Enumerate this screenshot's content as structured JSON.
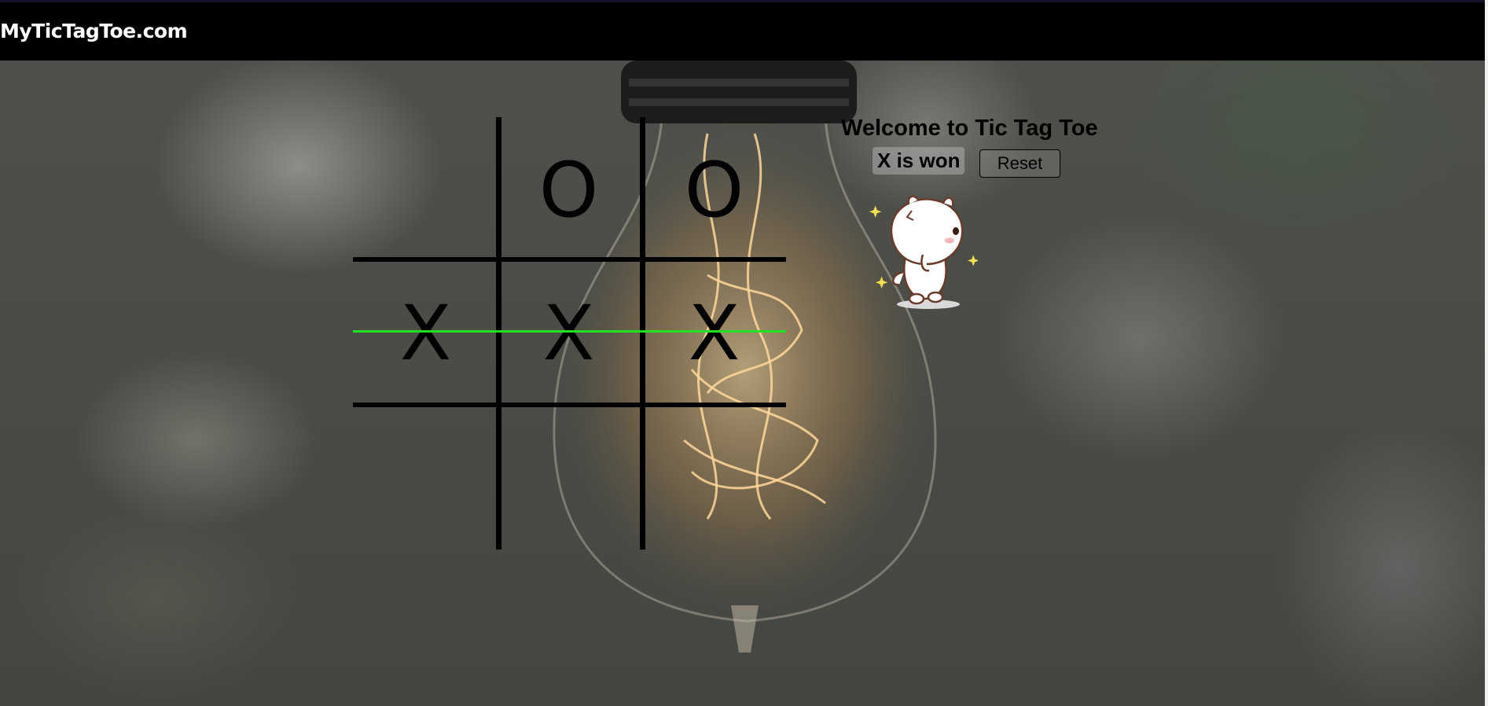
{
  "navbar": {
    "brand": "MyTicTagToe.com"
  },
  "game": {
    "title": "Welcome to Tic Tag Toe",
    "status": "X is won",
    "reset_label": "Reset",
    "board": [
      "",
      "O",
      "O",
      "X",
      "X",
      "X",
      "",
      "",
      ""
    ],
    "winning_line": "row-2",
    "win_color": "#22e022"
  },
  "mascot": {
    "icon": "cat-sticker-icon"
  }
}
